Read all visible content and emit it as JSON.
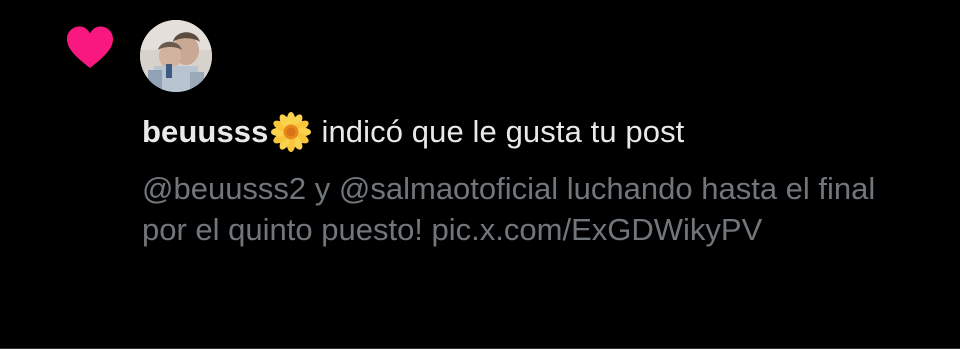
{
  "notification": {
    "type_icon": "heart-icon",
    "heart_color": "#f91880",
    "avatar_icon": "user-avatar",
    "username": "beuusss",
    "username_emoji_icon": "blossom-flower-icon",
    "action_text": "indicó que le gusta tu post",
    "post_preview": "@beuusss2 y @salmaotoficial luchando hasta el final por el quinto puesto! pic.x.com/ExGDWikyPV"
  },
  "colors": {
    "background": "#000000",
    "primary_text": "#e7e9ea",
    "secondary_text": "#71767b",
    "divider": "#2f3336"
  }
}
